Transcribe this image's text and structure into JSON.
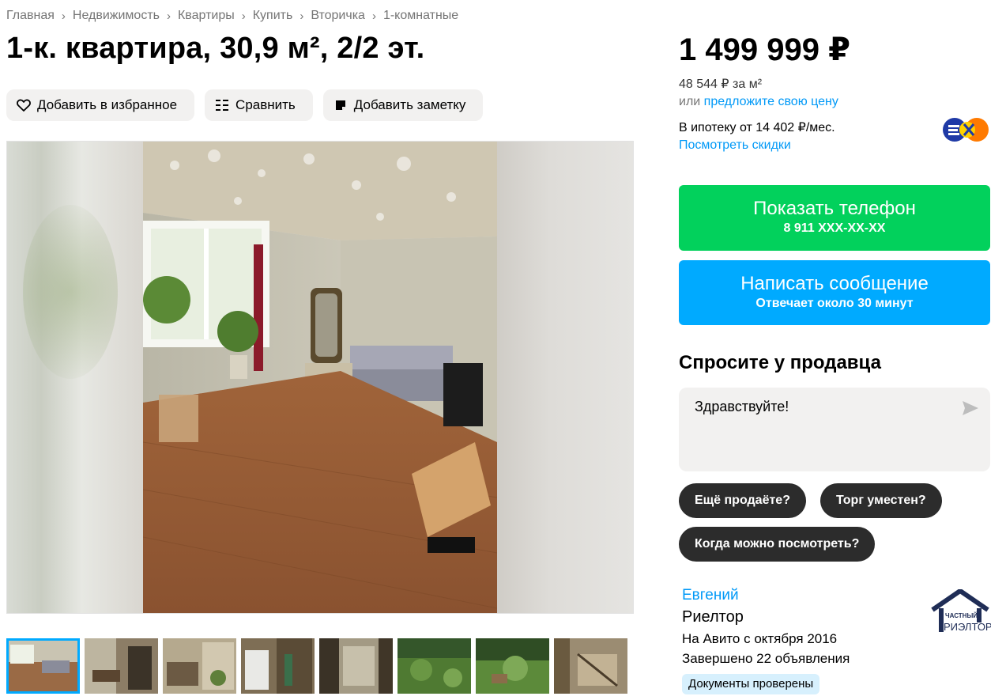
{
  "breadcrumbs": [
    "Главная",
    "Недвижимость",
    "Квартиры",
    "Купить",
    "Вторичка",
    "1-комнатные"
  ],
  "title": "1-к. квартира, 30,9 м², 2/2 эт.",
  "actions": {
    "favorite": "Добавить в избранное",
    "compare": "Сравнить",
    "note": "Добавить заметку"
  },
  "gallery": {
    "thumb_count": 8,
    "active_thumb": 1
  },
  "price": {
    "value": "1 499 999 ₽",
    "per_meter": "48 544 ₽ за м²",
    "offer_prefix": "или",
    "offer_link": "предложите свою цену",
    "mortgage": "В ипотеку от 14 402 ₽/мес.",
    "discounts": "Посмотреть скидки"
  },
  "contact": {
    "phone_label": "Показать телефон",
    "phone_masked": "8 911 XXX-XX-XX",
    "message_label": "Написать сообщение",
    "message_sub": "Отвечает около 30 минут"
  },
  "ask": {
    "title": "Спросите у продавца",
    "input_value": "Здравствуйте!",
    "chips": [
      "Ещё продаёте?",
      "Торг уместен?",
      "Когда можно посмотреть?"
    ]
  },
  "seller": {
    "name": "Евгений",
    "role": "Риелтор",
    "since": "На Авито с октября 2016",
    "completed": "Завершено 22 объявления",
    "badge": "Документы проверены",
    "logo_text_top": "ЧАСТНЫЙ",
    "logo_text_bottom": "РИЭЛТОР"
  },
  "colors": {
    "green": "#02d15c",
    "blue": "#00aaff",
    "link": "#0099f7",
    "chip": "#2c2c2c"
  }
}
